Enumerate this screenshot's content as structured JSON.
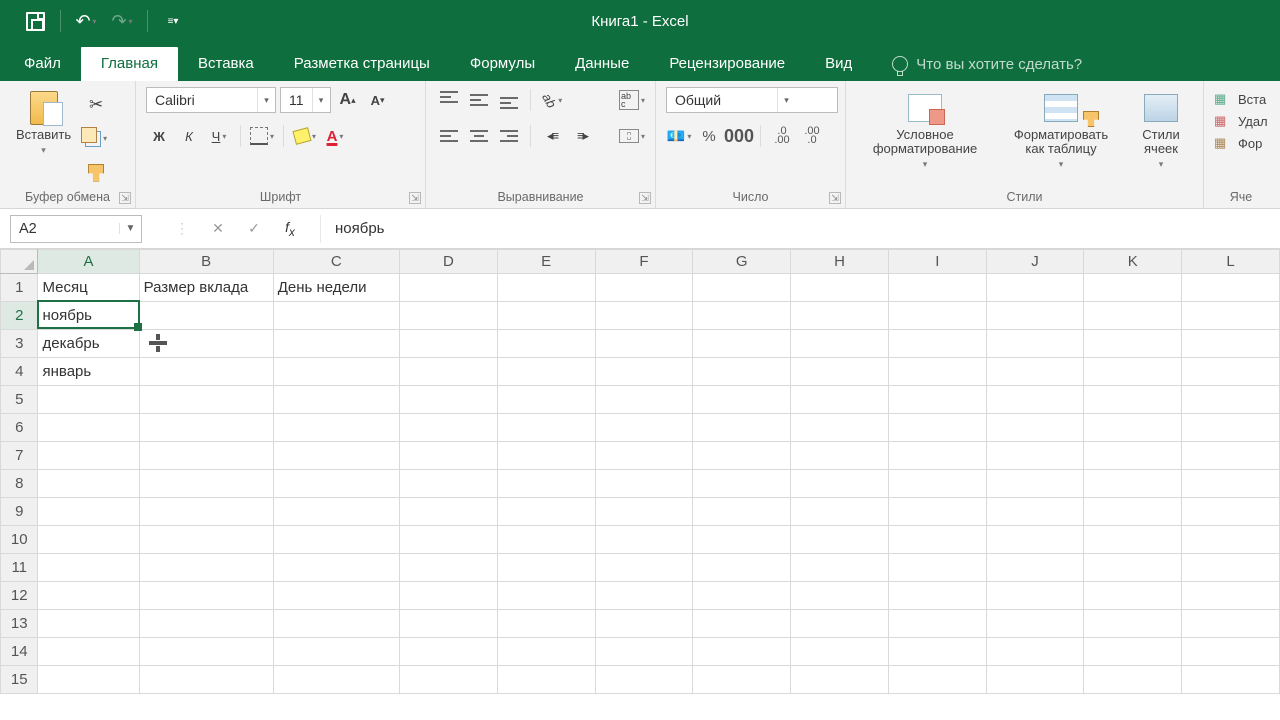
{
  "app": {
    "title": "Книга1 - Excel"
  },
  "tabs": {
    "file": "Файл",
    "home": "Главная",
    "insert": "Вставка",
    "layout": "Разметка страницы",
    "formulas": "Формулы",
    "data": "Данные",
    "review": "Рецензирование",
    "view": "Вид",
    "tellme": "Что вы хотите сделать?"
  },
  "ribbon": {
    "clipboard": {
      "label": "Буфер обмена",
      "paste": "Вставить"
    },
    "font": {
      "label": "Шрифт",
      "name": "Calibri",
      "size": "11",
      "bold": "Ж",
      "italic": "К",
      "underline": "Ч",
      "incfont": "A",
      "decfont": "A",
      "colorchar": "A"
    },
    "align": {
      "label": "Выравнивание"
    },
    "number": {
      "label": "Число",
      "format": "Общий",
      "comma": "000"
    },
    "styles": {
      "label": "Стили",
      "cf": "Условное форматирование",
      "table": "Форматировать как таблицу",
      "cell": "Стили ячеек"
    },
    "cells": {
      "label": "Яче",
      "insert": "Вста",
      "delete": "Удал",
      "format": "Фор"
    }
  },
  "fbar": {
    "ref": "A2",
    "value": "ноябрь"
  },
  "columns": [
    "A",
    "B",
    "C",
    "D",
    "E",
    "F",
    "G",
    "H",
    "I",
    "J",
    "K",
    "L"
  ],
  "rows_count": 15,
  "cells": {
    "A1": "Месяц",
    "B1": "Размер вклада",
    "C1": "День недели",
    "A2": "ноябрь",
    "A3": "декабрь",
    "A4": "январь"
  },
  "decinc": ".0\n.00",
  "decdec": ".00\n.0",
  "selected_cell": "A2",
  "cursor_row": 3,
  "cursor_col": "B"
}
